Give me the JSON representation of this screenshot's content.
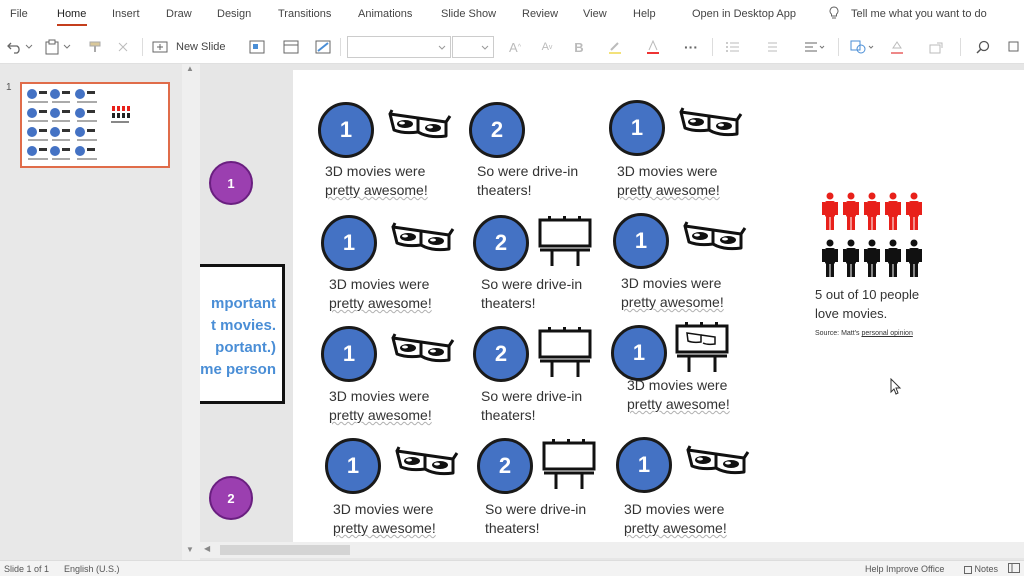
{
  "menu": {
    "file": "File",
    "home": "Home",
    "insert": "Insert",
    "draw": "Draw",
    "design": "Design",
    "transitions": "Transitions",
    "animations": "Animations",
    "slide_show": "Slide Show",
    "review": "Review",
    "view": "View",
    "help": "Help",
    "open_desktop": "Open in Desktop App",
    "tell_me": "Tell me what you want to do"
  },
  "toolbar": {
    "new_slide": "New Slide"
  },
  "thumbnail": {
    "number": "1"
  },
  "offslide_text": {
    "line1": "mportant",
    "line2": "t movies.",
    "line3": "portant.)",
    "line4": "ome person"
  },
  "purple_markers": [
    "1",
    "2"
  ],
  "slide": {
    "badge_numbers": {
      "one": "1",
      "two": "2"
    },
    "caption_3d": {
      "line1": "3D movies were",
      "line2": "pretty awesome!"
    },
    "caption_drivein": {
      "line1": "So were drive-in",
      "line2": "theaters!"
    },
    "stat_line1": "5 out of 10 people",
    "stat_line2": "love movies.",
    "source_prefix": "Source: Matt's ",
    "source_link": "personal opinion"
  },
  "status": {
    "slide_count": "Slide 1 of 1",
    "language": "English (U.S.)",
    "help_improve": "Help Improve Office",
    "notes": "Notes"
  },
  "colors": {
    "accent": "#c43e1c",
    "badge_blue": "#4472c4",
    "marker_purple": "#9b3fb0",
    "people_red": "#e8201a"
  }
}
